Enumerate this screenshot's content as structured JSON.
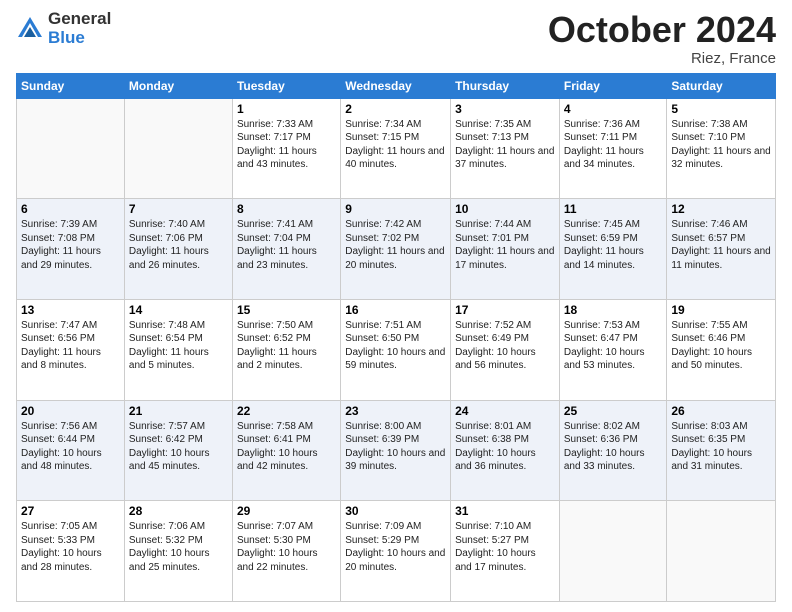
{
  "header": {
    "logo_line1": "General",
    "logo_line2": "Blue",
    "month": "October 2024",
    "location": "Riez, France"
  },
  "weekdays": [
    "Sunday",
    "Monday",
    "Tuesday",
    "Wednesday",
    "Thursday",
    "Friday",
    "Saturday"
  ],
  "weeks": [
    [
      {
        "day": "",
        "info": ""
      },
      {
        "day": "",
        "info": ""
      },
      {
        "day": "1",
        "info": "Sunrise: 7:33 AM\nSunset: 7:17 PM\nDaylight: 11 hours and 43 minutes."
      },
      {
        "day": "2",
        "info": "Sunrise: 7:34 AM\nSunset: 7:15 PM\nDaylight: 11 hours and 40 minutes."
      },
      {
        "day": "3",
        "info": "Sunrise: 7:35 AM\nSunset: 7:13 PM\nDaylight: 11 hours and 37 minutes."
      },
      {
        "day": "4",
        "info": "Sunrise: 7:36 AM\nSunset: 7:11 PM\nDaylight: 11 hours and 34 minutes."
      },
      {
        "day": "5",
        "info": "Sunrise: 7:38 AM\nSunset: 7:10 PM\nDaylight: 11 hours and 32 minutes."
      }
    ],
    [
      {
        "day": "6",
        "info": "Sunrise: 7:39 AM\nSunset: 7:08 PM\nDaylight: 11 hours and 29 minutes."
      },
      {
        "day": "7",
        "info": "Sunrise: 7:40 AM\nSunset: 7:06 PM\nDaylight: 11 hours and 26 minutes."
      },
      {
        "day": "8",
        "info": "Sunrise: 7:41 AM\nSunset: 7:04 PM\nDaylight: 11 hours and 23 minutes."
      },
      {
        "day": "9",
        "info": "Sunrise: 7:42 AM\nSunset: 7:02 PM\nDaylight: 11 hours and 20 minutes."
      },
      {
        "day": "10",
        "info": "Sunrise: 7:44 AM\nSunset: 7:01 PM\nDaylight: 11 hours and 17 minutes."
      },
      {
        "day": "11",
        "info": "Sunrise: 7:45 AM\nSunset: 6:59 PM\nDaylight: 11 hours and 14 minutes."
      },
      {
        "day": "12",
        "info": "Sunrise: 7:46 AM\nSunset: 6:57 PM\nDaylight: 11 hours and 11 minutes."
      }
    ],
    [
      {
        "day": "13",
        "info": "Sunrise: 7:47 AM\nSunset: 6:56 PM\nDaylight: 11 hours and 8 minutes."
      },
      {
        "day": "14",
        "info": "Sunrise: 7:48 AM\nSunset: 6:54 PM\nDaylight: 11 hours and 5 minutes."
      },
      {
        "day": "15",
        "info": "Sunrise: 7:50 AM\nSunset: 6:52 PM\nDaylight: 11 hours and 2 minutes."
      },
      {
        "day": "16",
        "info": "Sunrise: 7:51 AM\nSunset: 6:50 PM\nDaylight: 10 hours and 59 minutes."
      },
      {
        "day": "17",
        "info": "Sunrise: 7:52 AM\nSunset: 6:49 PM\nDaylight: 10 hours and 56 minutes."
      },
      {
        "day": "18",
        "info": "Sunrise: 7:53 AM\nSunset: 6:47 PM\nDaylight: 10 hours and 53 minutes."
      },
      {
        "day": "19",
        "info": "Sunrise: 7:55 AM\nSunset: 6:46 PM\nDaylight: 10 hours and 50 minutes."
      }
    ],
    [
      {
        "day": "20",
        "info": "Sunrise: 7:56 AM\nSunset: 6:44 PM\nDaylight: 10 hours and 48 minutes."
      },
      {
        "day": "21",
        "info": "Sunrise: 7:57 AM\nSunset: 6:42 PM\nDaylight: 10 hours and 45 minutes."
      },
      {
        "day": "22",
        "info": "Sunrise: 7:58 AM\nSunset: 6:41 PM\nDaylight: 10 hours and 42 minutes."
      },
      {
        "day": "23",
        "info": "Sunrise: 8:00 AM\nSunset: 6:39 PM\nDaylight: 10 hours and 39 minutes."
      },
      {
        "day": "24",
        "info": "Sunrise: 8:01 AM\nSunset: 6:38 PM\nDaylight: 10 hours and 36 minutes."
      },
      {
        "day": "25",
        "info": "Sunrise: 8:02 AM\nSunset: 6:36 PM\nDaylight: 10 hours and 33 minutes."
      },
      {
        "day": "26",
        "info": "Sunrise: 8:03 AM\nSunset: 6:35 PM\nDaylight: 10 hours and 31 minutes."
      }
    ],
    [
      {
        "day": "27",
        "info": "Sunrise: 7:05 AM\nSunset: 5:33 PM\nDaylight: 10 hours and 28 minutes."
      },
      {
        "day": "28",
        "info": "Sunrise: 7:06 AM\nSunset: 5:32 PM\nDaylight: 10 hours and 25 minutes."
      },
      {
        "day": "29",
        "info": "Sunrise: 7:07 AM\nSunset: 5:30 PM\nDaylight: 10 hours and 22 minutes."
      },
      {
        "day": "30",
        "info": "Sunrise: 7:09 AM\nSunset: 5:29 PM\nDaylight: 10 hours and 20 minutes."
      },
      {
        "day": "31",
        "info": "Sunrise: 7:10 AM\nSunset: 5:27 PM\nDaylight: 10 hours and 17 minutes."
      },
      {
        "day": "",
        "info": ""
      },
      {
        "day": "",
        "info": ""
      }
    ]
  ]
}
